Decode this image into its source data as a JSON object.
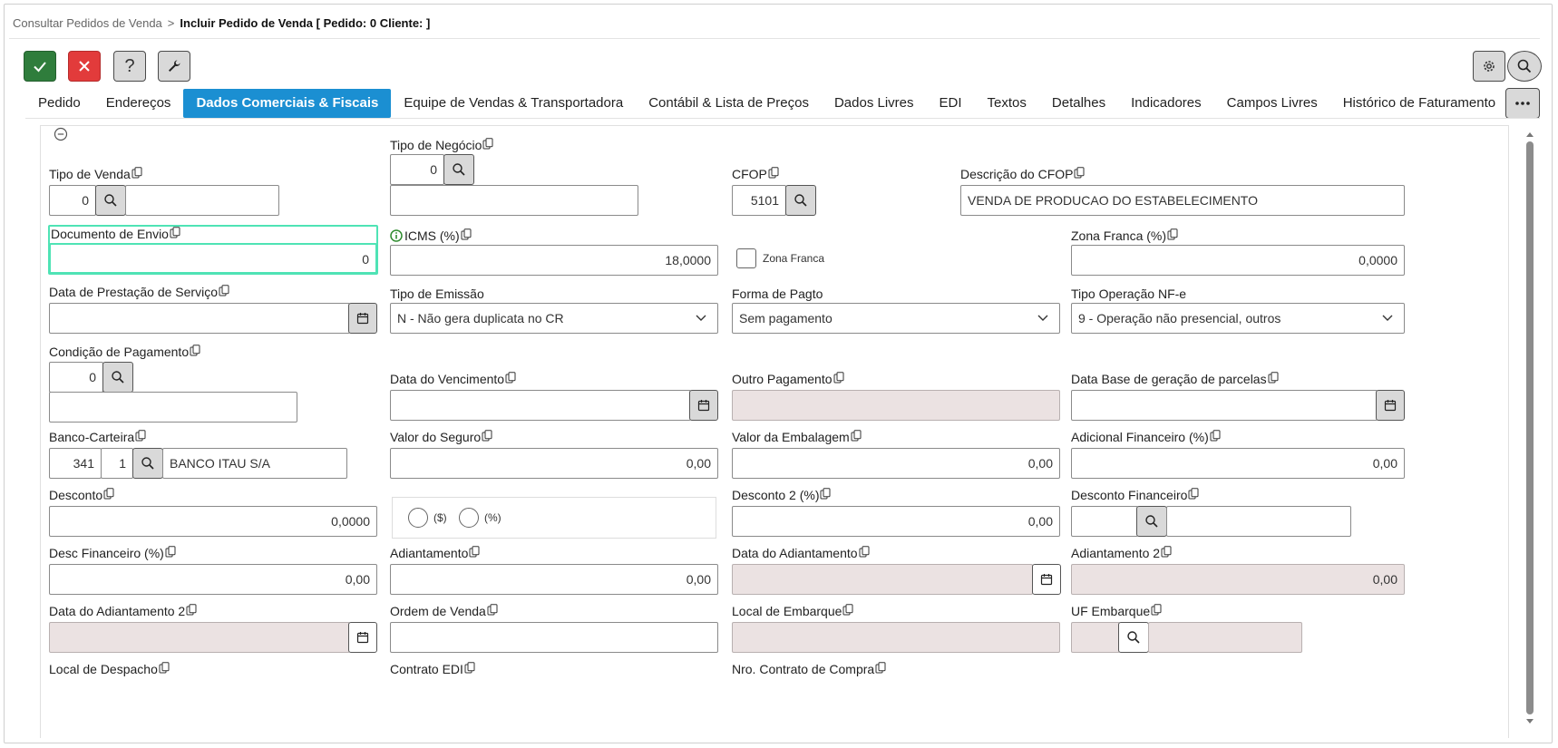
{
  "breadcrumb": {
    "parent": "Consultar Pedidos de Venda",
    "separator": ">",
    "current": "Incluir Pedido de Venda [ Pedido: 0 Cliente: ]"
  },
  "toolbar": {
    "confirm": "check-icon",
    "cancel": "close-icon",
    "help": "?",
    "tools": "wrench-icon",
    "settings": "gear-icon",
    "search": "search-icon"
  },
  "tabs": [
    {
      "label": "Pedido"
    },
    {
      "label": "Endereços"
    },
    {
      "label": "Dados Comerciais & Fiscais",
      "active": true
    },
    {
      "label": "Equipe de Vendas & Transportadora"
    },
    {
      "label": "Contábil & Lista de Preços"
    },
    {
      "label": "Dados Livres"
    },
    {
      "label": "EDI"
    },
    {
      "label": "Textos"
    },
    {
      "label": "Detalhes"
    },
    {
      "label": "Indicadores"
    },
    {
      "label": "Campos Livres"
    },
    {
      "label": "Histórico de Faturamento"
    }
  ],
  "form": {
    "tipo_venda": {
      "label": "Tipo de Venda",
      "code": "0",
      "desc": ""
    },
    "tipo_negocio": {
      "label": "Tipo de Negócio",
      "code": "0",
      "desc": ""
    },
    "cfop": {
      "label": "CFOP",
      "code": "5101"
    },
    "descricao_cfop": {
      "label": "Descrição do CFOP",
      "value": "VENDA DE PRODUCAO DO ESTABELECIMENTO"
    },
    "documento_envio": {
      "label": "Documento de Envio",
      "value": "0"
    },
    "icms": {
      "label": "ICMS (%)",
      "value": "18,0000"
    },
    "zona_franca_check": {
      "label": "Zona Franca"
    },
    "zona_franca_pct": {
      "label": "Zona Franca (%)",
      "value": "0,0000"
    },
    "data_prestacao": {
      "label": "Data de Prestação de Serviço",
      "value": ""
    },
    "tipo_emissao": {
      "label": "Tipo de Emissão",
      "value": "N - Não gera duplicata no CR"
    },
    "forma_pagto": {
      "label": "Forma de Pagto",
      "value": "Sem pagamento"
    },
    "tipo_operacao": {
      "label": "Tipo Operação NF-e",
      "value": "9 - Operação não presencial, outros"
    },
    "condicao_pagamento": {
      "label": "Condição de Pagamento",
      "code": "0",
      "desc": ""
    },
    "data_vencimento": {
      "label": "Data do Vencimento",
      "value": ""
    },
    "outro_pagamento": {
      "label": "Outro Pagamento",
      "value": ""
    },
    "data_base": {
      "label": "Data Base de geração de parcelas",
      "value": ""
    },
    "banco_carteira": {
      "label": "Banco-Carteira",
      "banco": "341",
      "carteira": "1",
      "desc": "BANCO ITAU S/A"
    },
    "valor_seguro": {
      "label": "Valor do Seguro",
      "value": "0,00"
    },
    "valor_embalagem": {
      "label": "Valor da Embalagem",
      "value": "0,00"
    },
    "adicional_financeiro": {
      "label": "Adicional Financeiro (%)",
      "value": "0,00"
    },
    "desconto": {
      "label": "Desconto",
      "value": "0,0000"
    },
    "radio_valor": {
      "label": "($)"
    },
    "radio_pct": {
      "label": "(%)"
    },
    "desconto2": {
      "label": "Desconto 2 (%)",
      "value": "0,00"
    },
    "desconto_financeiro": {
      "label": "Desconto Financeiro",
      "code": "",
      "desc": ""
    },
    "desc_financeiro_pct": {
      "label": "Desc Financeiro (%)",
      "value": "0,00"
    },
    "adiantamento": {
      "label": "Adiantamento",
      "value": "0,00"
    },
    "data_adiantamento": {
      "label": "Data do Adiantamento",
      "value": ""
    },
    "adiantamento2": {
      "label": "Adiantamento 2",
      "value": "0,00"
    },
    "data_adiantamento2": {
      "label": "Data do Adiantamento 2",
      "value": ""
    },
    "ordem_venda": {
      "label": "Ordem de Venda",
      "value": ""
    },
    "local_embarque": {
      "label": "Local de Embarque",
      "value": ""
    },
    "uf_embarque": {
      "label": "UF Embarque",
      "code": "",
      "desc": ""
    },
    "local_despacho": {
      "label": "Local de Despacho"
    },
    "contrato_edi": {
      "label": "Contrato EDI"
    },
    "nro_contrato": {
      "label": "Nro. Contrato de Compra"
    }
  }
}
